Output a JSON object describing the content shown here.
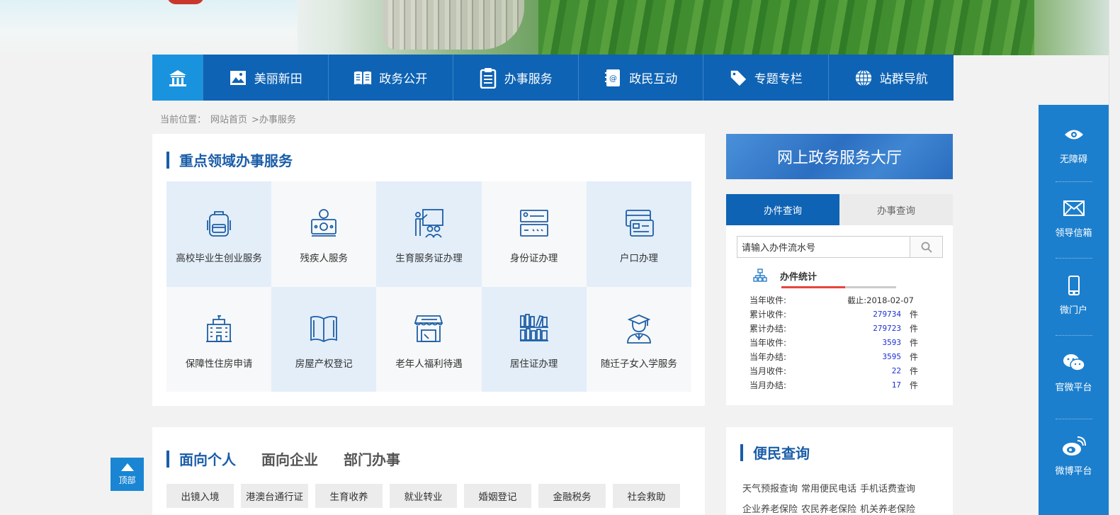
{
  "nav": {
    "items": [
      {
        "label": "美丽新田",
        "icon": "image-icon"
      },
      {
        "label": "政务公开",
        "icon": "open-book-icon"
      },
      {
        "label": "办事服务",
        "icon": "clipboard-icon"
      },
      {
        "label": "政民互动",
        "icon": "address-book-icon"
      },
      {
        "label": "专题专栏",
        "icon": "tag-icon"
      },
      {
        "label": "站群导航",
        "icon": "globe-icon"
      }
    ]
  },
  "breadcrumb": {
    "prefix": "当前位置：",
    "home": "网站首页",
    "current": ">办事服务"
  },
  "services": {
    "title": "重点领域办事服务",
    "items": [
      {
        "label": "高校毕业生创业服务",
        "icon": "backpack-icon"
      },
      {
        "label": "残疾人服务",
        "icon": "money-icon"
      },
      {
        "label": "生育服务证办理",
        "icon": "family-board-icon"
      },
      {
        "label": "身份证办理",
        "icon": "id-card-icon"
      },
      {
        "label": "户口办理",
        "icon": "register-card-icon"
      },
      {
        "label": "保障性住房申请",
        "icon": "building-icon"
      },
      {
        "label": "房屋产权登记",
        "icon": "book-icon"
      },
      {
        "label": "老年人福利待遇",
        "icon": "shop-icon"
      },
      {
        "label": "居住证办理",
        "icon": "bookshelf-icon"
      },
      {
        "label": "随迁子女入学服务",
        "icon": "graduate-icon"
      }
    ]
  },
  "hall": {
    "label": "网上政务服务大厅"
  },
  "query": {
    "tabs": [
      "办件查询",
      "办事查询"
    ],
    "placeholder": "请输入办件流水号",
    "stats_title": "办件统计",
    "date_label": "当年收件:",
    "date": "截止:2018-02-07",
    "unit": "件",
    "rows": [
      {
        "k": "累计收件:",
        "v": "279734"
      },
      {
        "k": "累计办结:",
        "v": "279723"
      },
      {
        "k": "当年收件:",
        "v": "3593"
      },
      {
        "k": "当年办结:",
        "v": "3595"
      },
      {
        "k": "当月收件:",
        "v": "22"
      },
      {
        "k": "当月办结:",
        "v": "17"
      }
    ]
  },
  "lower": {
    "tabs": [
      "面向个人",
      "面向企业",
      "部门办事"
    ],
    "chips": [
      "出镜入境",
      "港澳台通行证",
      "生育收养",
      "就业转业",
      "婚姻登记",
      "金融税务",
      "社会救助"
    ]
  },
  "convenience": {
    "title": "便民查询",
    "links": [
      "天气预报查询",
      "常用便民电话",
      "手机话费查询",
      "企业养老保险",
      "农民养老保险",
      "机关养老保险"
    ]
  },
  "sidebar": {
    "items": [
      {
        "label": "无障碍",
        "icon": "eye-icon"
      },
      {
        "label": "领导信箱",
        "icon": "mail-icon"
      },
      {
        "label": "微门户",
        "icon": "phone-icon"
      },
      {
        "label": "官微平台",
        "icon": "wechat-icon"
      },
      {
        "label": "微博平台",
        "icon": "weibo-icon"
      }
    ]
  },
  "top_button": {
    "label": "顶部"
  },
  "colors": {
    "nav": "#0e63b4",
    "nav_active": "#1a93de",
    "accent": "#1a5da8",
    "sidebar": "#1c7fcd",
    "stat_value": "#1b2fd6",
    "progress": "#e6463c"
  }
}
